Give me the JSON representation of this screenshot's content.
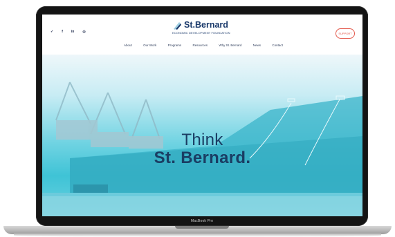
{
  "device": {
    "label": "MacBook Pro"
  },
  "header": {
    "social_icons": [
      {
        "name": "twitter-icon",
        "glyph": "✓"
      },
      {
        "name": "facebook-icon",
        "glyph": "f"
      },
      {
        "name": "linkedin-icon",
        "glyph": "in"
      },
      {
        "name": "instagram-icon",
        "glyph": "◎"
      }
    ],
    "logo": {
      "name": "St.Bernard",
      "subtitle": "ECONOMIC DEVELOPMENT FOUNDATION"
    },
    "support_label": "SUPPORT"
  },
  "nav": {
    "items": [
      {
        "label": "About"
      },
      {
        "label": "Our Work"
      },
      {
        "label": "Programs"
      },
      {
        "label": "Resources"
      },
      {
        "label": "Why St. Bernard"
      },
      {
        "label": "News"
      },
      {
        "label": "Contact"
      }
    ]
  },
  "hero": {
    "line1": "Think",
    "line2": "St. Bernard."
  },
  "colors": {
    "brand": "#1b3a6b",
    "accent": "#e3574a",
    "hero_teal": "#3fc3d6"
  }
}
